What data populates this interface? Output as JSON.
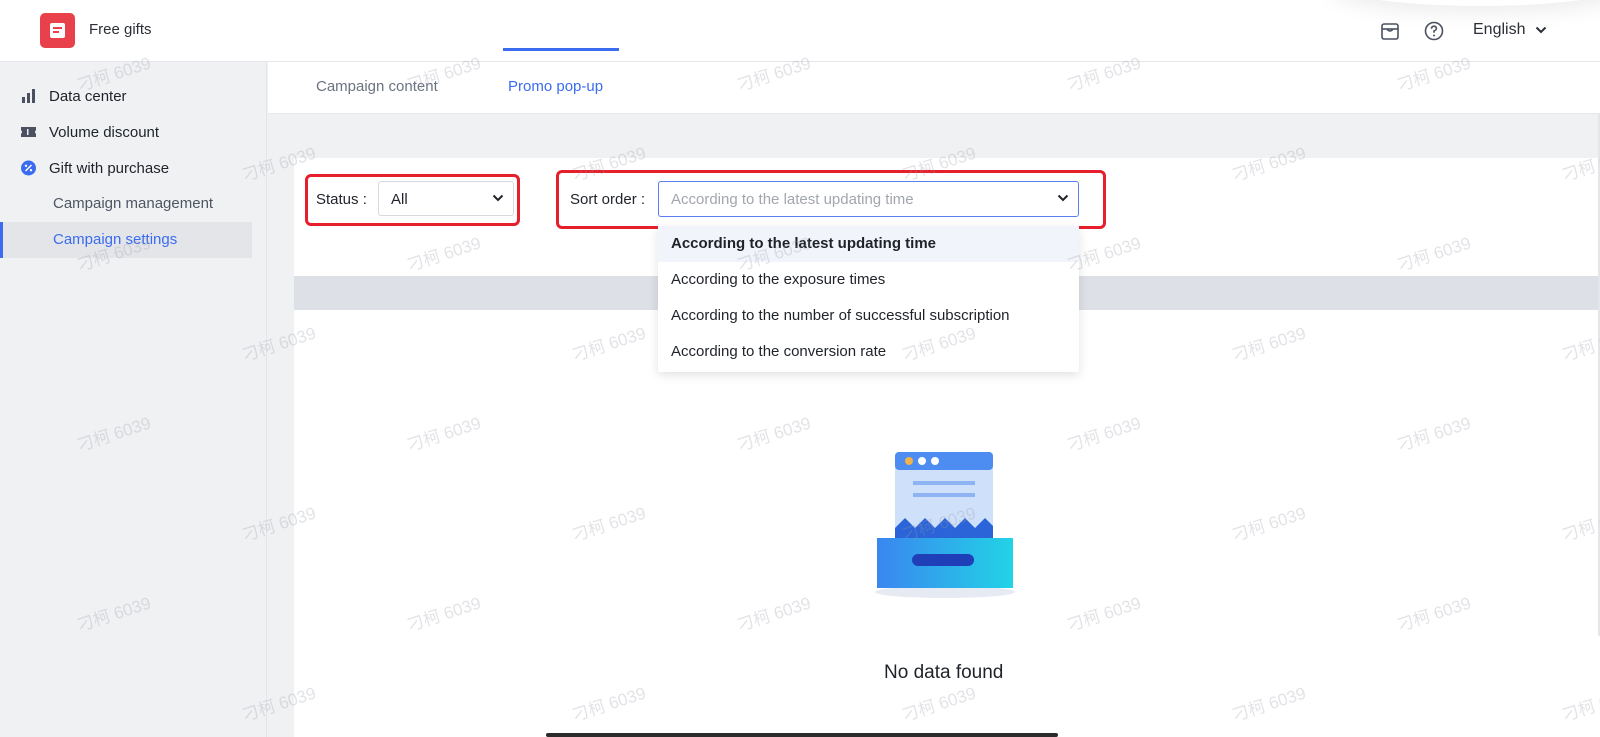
{
  "header": {
    "app_title": "Free gifts",
    "language": "English",
    "icons": [
      "store-icon",
      "help-icon",
      "chevron-down-icon"
    ]
  },
  "sidebar": {
    "items": [
      {
        "label": "Data center",
        "icon": "bar-chart-icon"
      },
      {
        "label": "Volume discount",
        "icon": "ticket-icon"
      },
      {
        "label": "Gift with purchase",
        "icon": "percent-badge-icon"
      }
    ],
    "sub_items": [
      {
        "label": "Campaign management",
        "active": false
      },
      {
        "label": "Campaign settings",
        "active": true
      }
    ]
  },
  "tabs": [
    {
      "label": "Campaign content",
      "active": false
    },
    {
      "label": "Promo pop-up",
      "active": true
    }
  ],
  "filters": {
    "status_label": "Status :",
    "status_value": "All",
    "sort_label": "Sort order :",
    "sort_placeholder": "According to the latest updating time"
  },
  "dropdown": {
    "options": [
      "According to the latest updating time",
      "According to the exposure times",
      "According to the number of successful subscription",
      "According to the conversion rate"
    ],
    "selected_index": 0
  },
  "empty_state": {
    "message": "No data found"
  },
  "watermark": "刁柯 6039",
  "colors": {
    "accent": "#3b6cf0",
    "brand": "#e8414b",
    "highlight": "#e5202c"
  }
}
